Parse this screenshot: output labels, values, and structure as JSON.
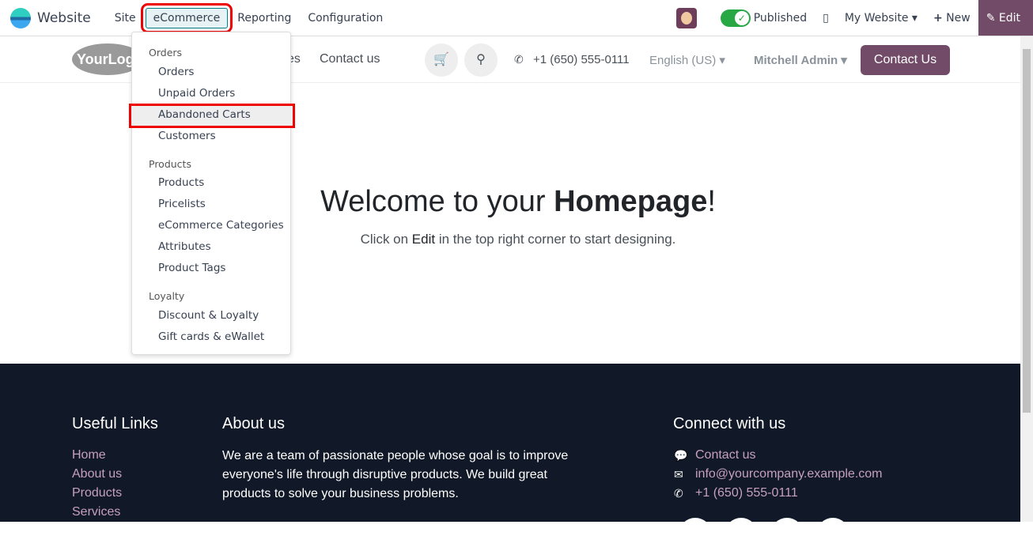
{
  "topbar": {
    "app": "Website",
    "menu": [
      "Site",
      "eCommerce",
      "Reporting",
      "Configuration"
    ],
    "published": "Published",
    "website": "My Website",
    "new": "New",
    "edit": "Edit"
  },
  "sitebar": {
    "logo": "YourLogo",
    "nav": [
      "ses",
      "Contact us"
    ],
    "phone": "+1 (650) 555-0111",
    "language": "English (US)",
    "user": "Mitchell Admin",
    "contact_btn": "Contact Us"
  },
  "dropdown": {
    "sections": [
      {
        "header": "Orders",
        "items": [
          "Orders",
          "Unpaid Orders",
          "Abandoned Carts",
          "Customers"
        ]
      },
      {
        "header": "Products",
        "items": [
          "Products",
          "Pricelists",
          "eCommerce Categories",
          "Attributes",
          "Product Tags"
        ]
      },
      {
        "header": "Loyalty",
        "items": [
          "Discount & Loyalty",
          "Gift cards & eWallet"
        ]
      }
    ],
    "highlighted": "Abandoned Carts"
  },
  "hero": {
    "title_pre": "Welcome to your ",
    "title_bold": "Homepage",
    "title_post": "!",
    "sub_pre": "Click on ",
    "sub_bold": "Edit",
    "sub_post": " in the top right corner to start designing."
  },
  "footer": {
    "useful_title": "Useful Links",
    "links": [
      "Home",
      "About us",
      "Products",
      "Services"
    ],
    "about_title": "About us",
    "about_text": "We are a team of passionate people whose goal is to improve everyone's life through disruptive products. We build great products to solve your business problems.",
    "connect_title": "Connect with us",
    "contact": [
      "Contact us",
      "info@yourcompany.example.com",
      "+1 (650) 555-0111"
    ]
  },
  "colors": {
    "brand": "#714b67",
    "footer_bg": "#111827",
    "highlight": "#ee0000"
  }
}
